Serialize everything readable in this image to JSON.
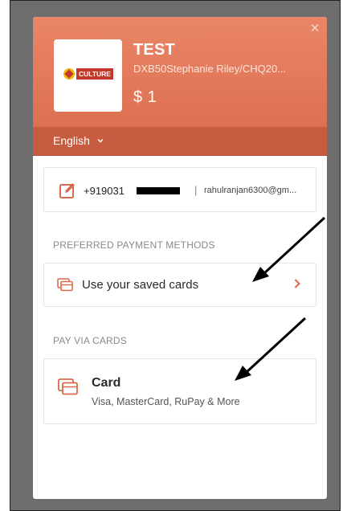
{
  "merchant": {
    "logo_text": "CULTURE",
    "name": "TEST",
    "description": "DXB50Stephanie Riley/CHQ20...",
    "amount": "$ 1"
  },
  "header": {
    "close_icon": "close-icon",
    "language": "English"
  },
  "contact": {
    "phone": "+919031",
    "separator": "|",
    "email": "rahulranjan6300@gm..."
  },
  "preferred": {
    "section_label": "PREFERRED PAYMENT METHODS",
    "saved_cards_label": "Use your saved cards"
  },
  "cards": {
    "section_label": "PAY VIA CARDS",
    "title": "Card",
    "subtitle": "Visa, MasterCard, RuPay & More"
  },
  "colors": {
    "accent": "#d96a4c",
    "header_top": "#ea8667",
    "lang_bar": "#c65c40",
    "overlay": "#6d6d6d"
  }
}
